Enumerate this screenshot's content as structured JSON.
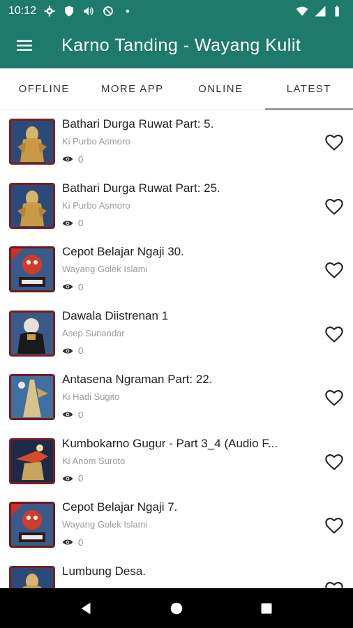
{
  "status_bar": {
    "time": "10:12"
  },
  "app_bar": {
    "title": "Karno Tanding - Wayang Kulit"
  },
  "tabs": [
    {
      "label": "OFFLINE",
      "active": false
    },
    {
      "label": "MORE APP",
      "active": false
    },
    {
      "label": "ONLINE",
      "active": false
    },
    {
      "label": "LATEST",
      "active": true
    }
  ],
  "items": [
    {
      "title": "Bathari Durga Ruwat Part: 5.",
      "artist": "Ki Purbo Asmoro",
      "views": "0",
      "thumb": "wayang-gold"
    },
    {
      "title": "Bathari Durga Ruwat Part: 25.",
      "artist": "Ki Purbo Asmoro",
      "views": "0",
      "thumb": "wayang-gold"
    },
    {
      "title": "Cepot Belajar Ngaji 30.",
      "artist": "Wayang Golek Islami",
      "views": "0",
      "thumb": "cepot-red"
    },
    {
      "title": "Dawala Diistrenan 1",
      "artist": "Asep Sunandar",
      "views": "0",
      "thumb": "golek-dark"
    },
    {
      "title": "Antasena Ngraman Part: 22.",
      "artist": "Ki Hadi Sugito",
      "views": "0",
      "thumb": "wayang-blue"
    },
    {
      "title": "Kumbokarno Gugur - Part 3_4 (Audio F...",
      "artist": "Ki Anom Suroto",
      "views": "0",
      "thumb": "wayang-night"
    },
    {
      "title": "Cepot Belajar Ngaji 7.",
      "artist": "Wayang Golek Islami",
      "views": "0",
      "thumb": "cepot-red"
    },
    {
      "title": "Lumbung Desa.",
      "artist": "",
      "views": "",
      "thumb": "wayang-gold"
    }
  ],
  "icons": {
    "menu": "hamburger-icon",
    "favorite": "heart-outline-icon",
    "views": "eye-icon",
    "nav_back": "triangle-back-icon",
    "nav_home": "circle-home-icon",
    "nav_recents": "square-recents-icon"
  },
  "colors": {
    "primary": "#1e7a6a",
    "tab_indicator": "#9b9b9b"
  }
}
